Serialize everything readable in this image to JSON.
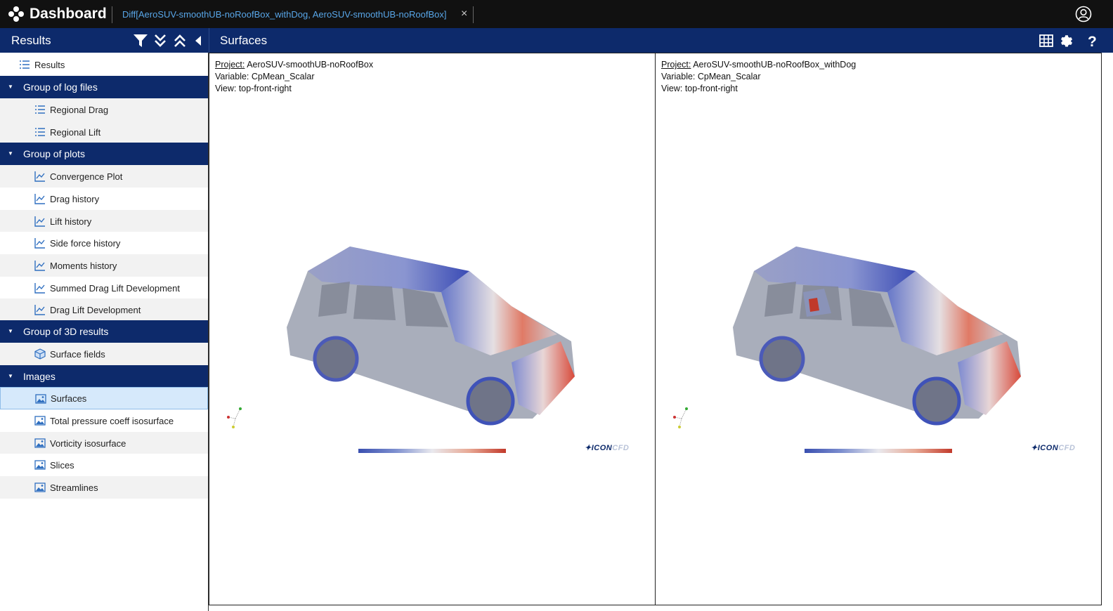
{
  "app": {
    "title": "Dashboard"
  },
  "tab": {
    "label": "Diff[AeroSUV-smoothUB-noRoofBox_withDog, AeroSUV-smoothUB-noRoofBox]",
    "close": "×"
  },
  "header": {
    "results_title": "Results",
    "panel_title": "Surfaces"
  },
  "colors": {
    "topbar": "#111111",
    "header": "#0d2a6b",
    "tab_text": "#58a6e8",
    "selected": "#d6e9fb"
  },
  "sidebar": {
    "root": "Results",
    "groups": [
      {
        "label": "Group of log files",
        "items": [
          "Regional Drag",
          "Regional Lift"
        ],
        "icon": "list-icon"
      },
      {
        "label": "Group of plots",
        "items": [
          "Convergence Plot",
          "Drag history",
          "Lift history",
          "Side force history",
          "Moments history",
          "Summed Drag Lift Development",
          "Drag Lift Development"
        ],
        "icon": "chart-line-icon"
      },
      {
        "label": "Group of 3D results",
        "items": [
          "Surface fields"
        ],
        "icon": "cube-icon"
      },
      {
        "label": "Images",
        "items": [
          "Surfaces",
          "Total pressure coeff isosurface",
          "Vorticity isosurface",
          "Slices",
          "Streamlines"
        ],
        "icon": "image-icon"
      }
    ],
    "selected_item": "Surfaces"
  },
  "viewports": [
    {
      "project_label": "Project:",
      "project": "AeroSUV-smoothUB-noRoofBox",
      "variable": "Variable: CpMean_Scalar",
      "view": "View: top-front-right"
    },
    {
      "project_label": "Project:",
      "project": "AeroSUV-smoothUB-noRoofBox_withDog",
      "variable": "Variable: CpMean_Scalar",
      "view": "View: top-front-right"
    }
  ]
}
